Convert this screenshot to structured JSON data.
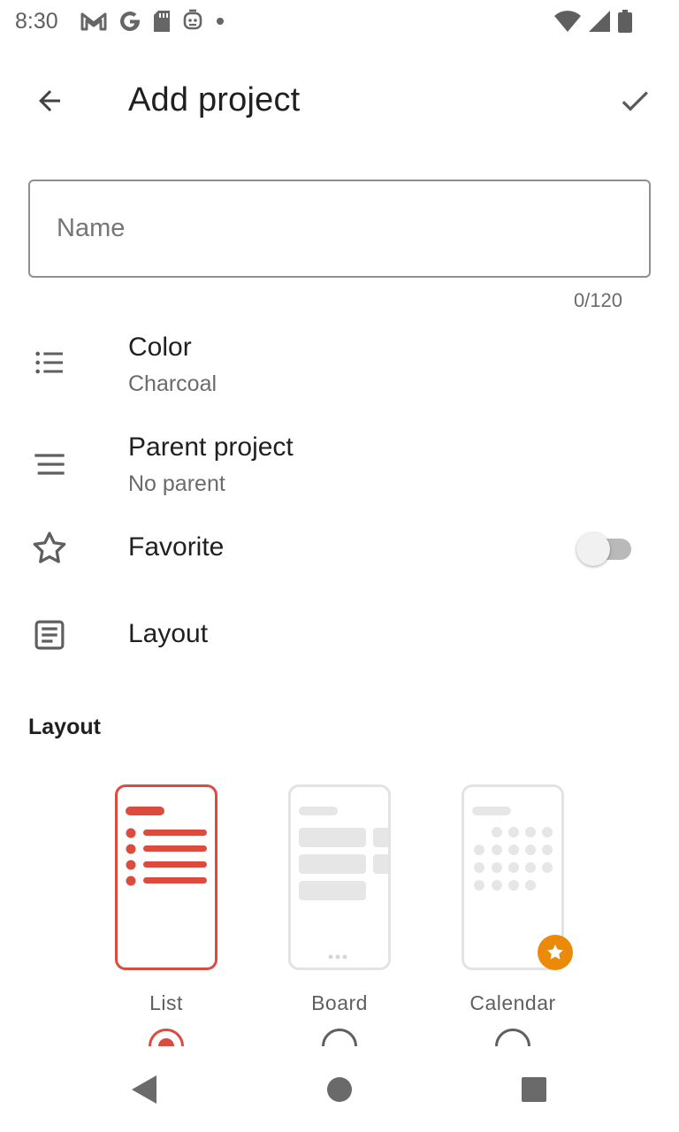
{
  "status_bar": {
    "time": "8:30",
    "icons": [
      "gmail-icon",
      "google-icon",
      "sd-card-icon",
      "assistant-icon",
      "dot-icon",
      "wifi-icon",
      "signal-icon",
      "battery-icon"
    ]
  },
  "app_bar": {
    "title": "Add project",
    "back_icon": "arrow-back-icon",
    "confirm_icon": "check-icon"
  },
  "name_field": {
    "placeholder": "Name",
    "value": "",
    "counter": "0/120"
  },
  "settings": {
    "color": {
      "title": "Color",
      "value": "Charcoal",
      "icon": "list-dots-icon"
    },
    "parent": {
      "title": "Parent project",
      "value": "No parent",
      "icon": "menu-lines-icon"
    },
    "favorite": {
      "title": "Favorite",
      "enabled": false,
      "icon": "star-outline-icon"
    },
    "layout": {
      "title": "Layout",
      "icon": "article-icon"
    }
  },
  "layout_section": {
    "title": "Layout",
    "options": [
      {
        "label": "List",
        "selected": true
      },
      {
        "label": "Board",
        "selected": false
      },
      {
        "label": "Calendar",
        "selected": false,
        "premium": true
      }
    ]
  },
  "colors": {
    "accent": "#db4c3f",
    "premium": "#eb8909",
    "text_primary": "#202020",
    "text_secondary": "#6b6b6b"
  },
  "nav_bar": {
    "icons": [
      "nav-back-icon",
      "nav-home-icon",
      "nav-recents-icon"
    ]
  }
}
